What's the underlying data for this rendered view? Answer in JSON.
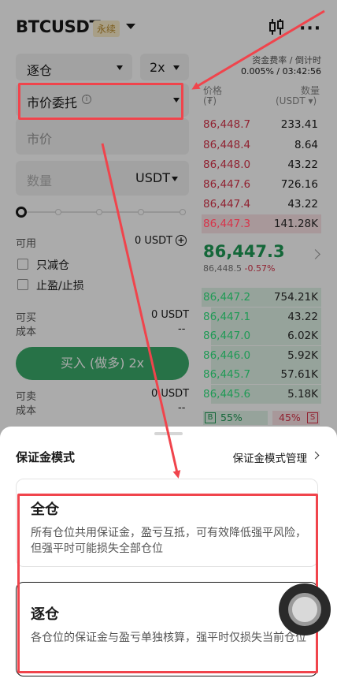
{
  "header": {
    "symbol": "BTCUSDT",
    "perp_tag": "永续"
  },
  "funding": {
    "label": "资金费率 / 倒计时",
    "value": "0.005% / 03:42:56"
  },
  "form": {
    "margin_mode": "逐仓",
    "leverage": "2x",
    "order_type": "市价委托",
    "market_placeholder": "市价",
    "qty_placeholder": "数量",
    "qty_unit": "USDT",
    "available_label": "可用",
    "available_value": "0 USDT",
    "reduce_only": "只减仓",
    "tp_sl": "止盈/止损",
    "can_buy_label": "可买",
    "can_buy_value": "0 USDT",
    "cost_label": "成本",
    "cost_value": "--",
    "buy_button": "买入 (做多) 2x",
    "can_sell_label": "可卖",
    "can_sell_value": "0 USDT",
    "cost2_label": "成本",
    "cost2_value": "--",
    "slider_position": 0
  },
  "orderbook": {
    "price_header": "价格",
    "price_unit": "(₮)",
    "qty_header": "数量",
    "qty_unit": "(USDT ▾)",
    "asks": [
      {
        "price": "86,448.7",
        "qty": "233.41"
      },
      {
        "price": "86,448.4",
        "qty": "8.64"
      },
      {
        "price": "86,448.0",
        "qty": "43.22"
      },
      {
        "price": "86,447.6",
        "qty": "726.16"
      },
      {
        "price": "86,447.4",
        "qty": "43.22"
      },
      {
        "price": "86,447.3",
        "qty": "141.28K"
      }
    ],
    "last_price": "86,447.3",
    "mark_price": "86,448.5",
    "change": "-0.57%",
    "bids": [
      {
        "price": "86,447.2",
        "qty": "754.21K"
      },
      {
        "price": "86,447.1",
        "qty": "43.22"
      },
      {
        "price": "86,447.0",
        "qty": "6.02K"
      },
      {
        "price": "86,446.0",
        "qty": "5.92K"
      },
      {
        "price": "86,445.7",
        "qty": "57.61K"
      },
      {
        "price": "86,445.6",
        "qty": "5.18K"
      }
    ],
    "buy_tag": "B",
    "buy_pct": "55%",
    "sell_pct": "45%",
    "sell_tag": "S"
  },
  "sheet": {
    "title": "保证金模式",
    "manage_link": "保证金模式管理",
    "options": [
      {
        "title": "全仓",
        "desc": "所有仓位共用保证金，盈亏互抵，可有效降低强平风险，但强平时可能损失全部仓位"
      },
      {
        "title": "逐仓",
        "desc": "各仓位的保证金与盈亏单独核算，强平时仅损失当前仓位"
      }
    ]
  },
  "colors": {
    "buy": "#1f9a55",
    "sell": "#d8344a",
    "annotation": "#f0444c"
  }
}
